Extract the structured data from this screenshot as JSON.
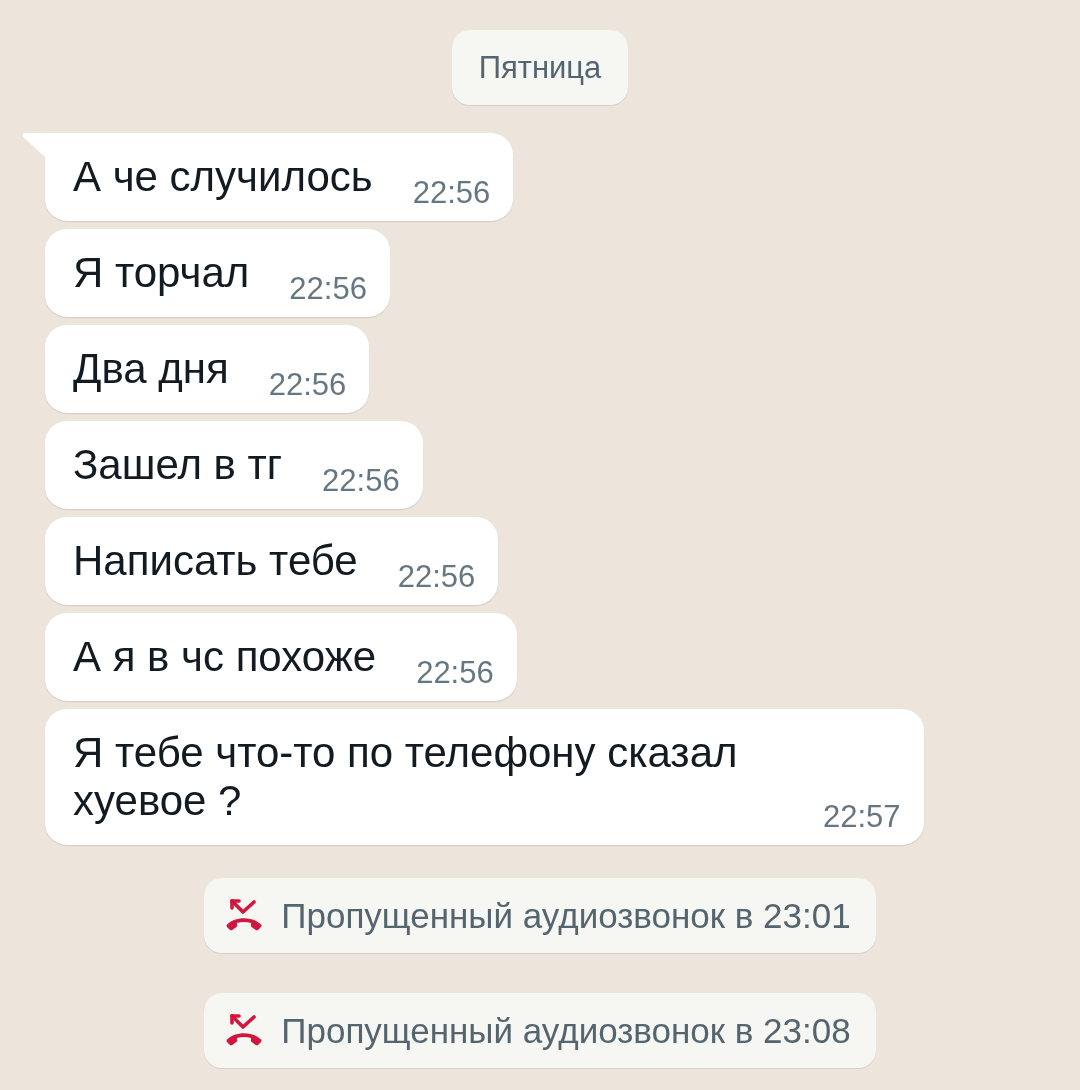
{
  "date_chip": "Пятница",
  "messages": [
    {
      "text": "А че случилось",
      "time": "22:56",
      "tail": true
    },
    {
      "text": "Я торчал",
      "time": "22:56",
      "tail": false
    },
    {
      "text": "Два дня",
      "time": "22:56",
      "tail": false
    },
    {
      "text": "Зашел в тг",
      "time": "22:56",
      "tail": false
    },
    {
      "text": "Написать тебе",
      "time": "22:56",
      "tail": false
    },
    {
      "text": "А я в чс похоже",
      "time": "22:56",
      "tail": false
    },
    {
      "text": "Я тебе что-то по телефону сказал хуевое ?",
      "time": "22:57",
      "tail": false
    }
  ],
  "events": [
    {
      "kind": "missed_audio_call",
      "text": "Пропущенный аудиозвонок в 23:01"
    },
    {
      "kind": "missed_audio_call",
      "text": "Пропущенный аудиозвонок в 23:08"
    }
  ]
}
